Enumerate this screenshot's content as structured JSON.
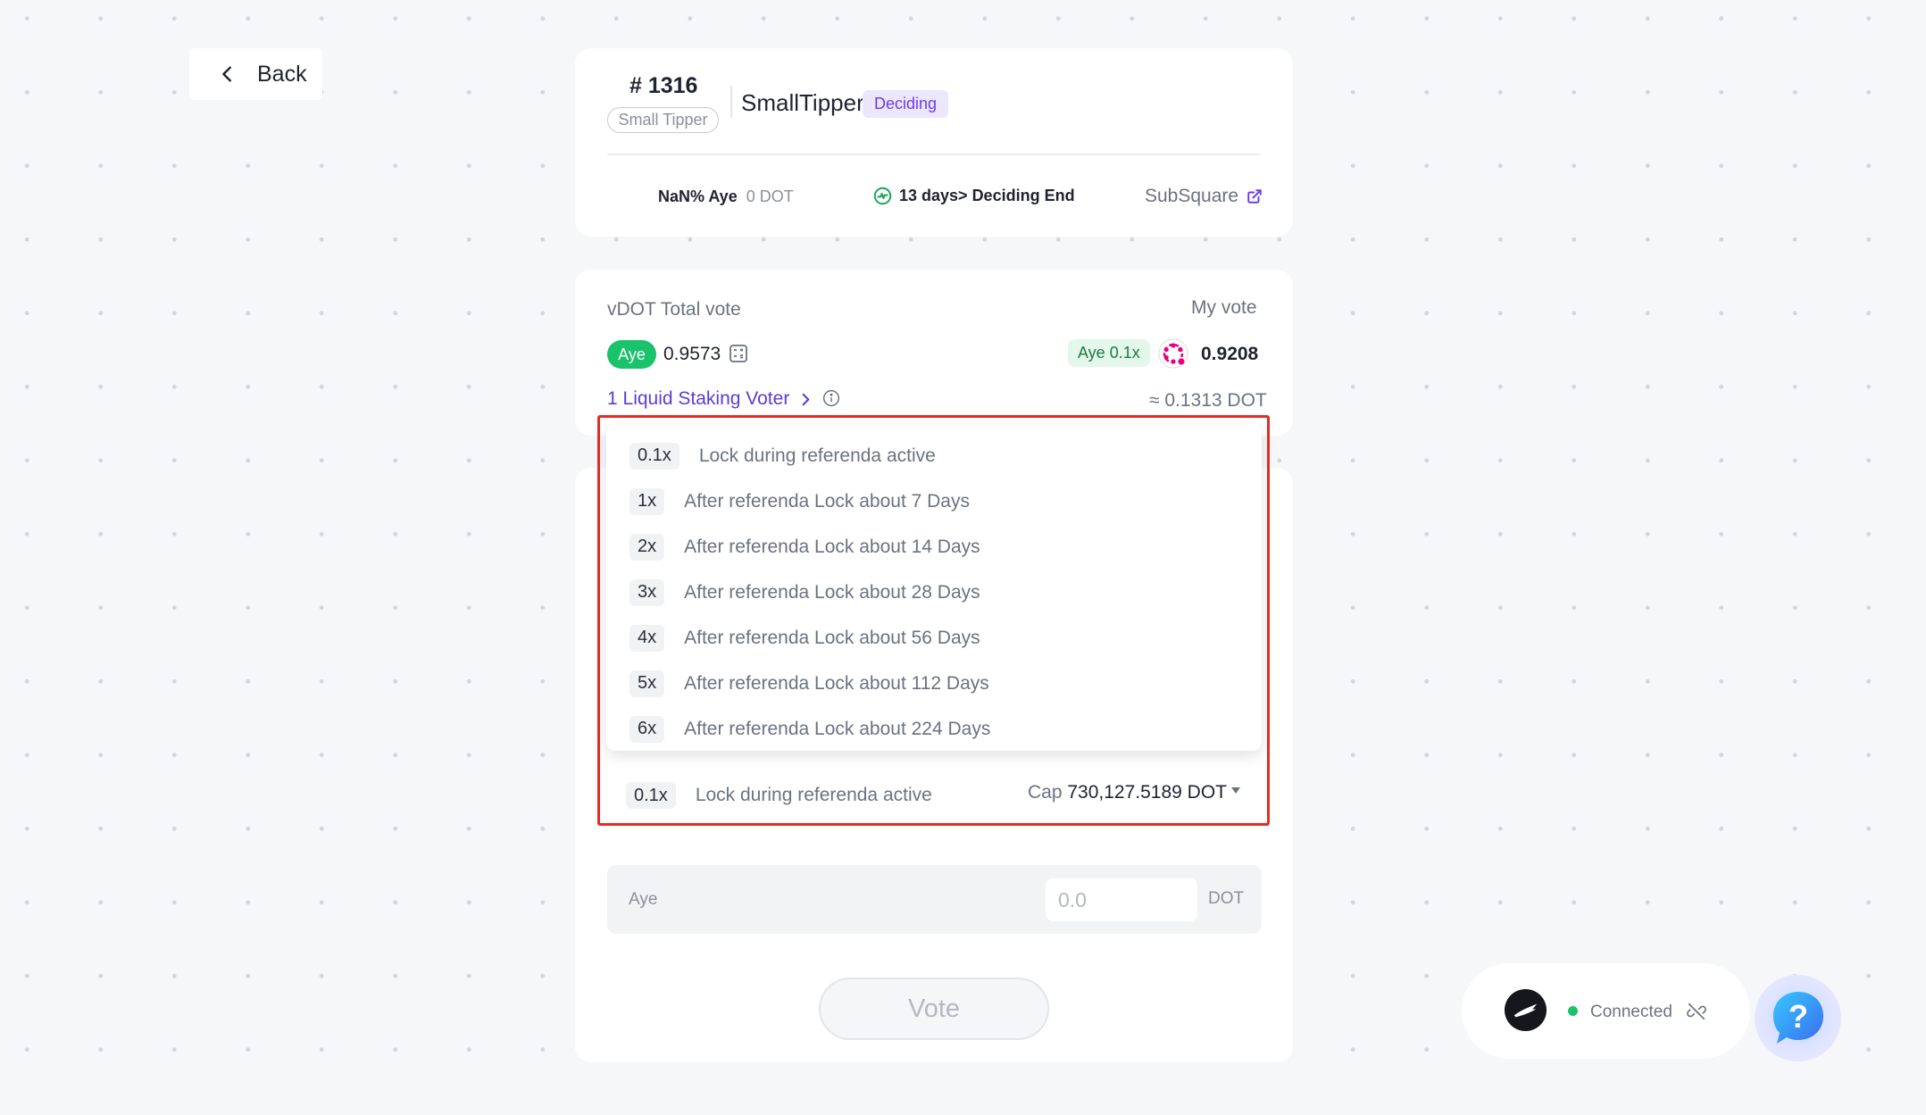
{
  "nav": {
    "back_label": "Back",
    "back_icon": "chevron-left-icon"
  },
  "referendum": {
    "number": "# 1316",
    "track": "Small Tipper",
    "title": "SmallTipper",
    "status": "Deciding",
    "aye_percent": "NaN% Aye",
    "aye_amount": "0 DOT",
    "deciding_text": "13 days> Deciding End",
    "link_label": "SubSquare"
  },
  "votes": {
    "total_label": "vDOT Total vote",
    "my_vote_label": "My vote",
    "aye_label": "Aye",
    "total_value": "0.9573",
    "my_vote_badge": "Aye 0.1x",
    "my_vote_value": "0.9208",
    "voters_link": "1 Liquid Staking Voter",
    "approx_dot": "≈ 0.1313 DOT"
  },
  "conviction_options": [
    {
      "multiplier": "0.1x",
      "label": "Lock during referenda active"
    },
    {
      "multiplier": "1x",
      "label": "After referenda Lock about 7 Days"
    },
    {
      "multiplier": "2x",
      "label": "After referenda Lock about 14 Days"
    },
    {
      "multiplier": "3x",
      "label": "After referenda Lock about 28 Days"
    },
    {
      "multiplier": "4x",
      "label": "After referenda Lock about 56 Days"
    },
    {
      "multiplier": "5x",
      "label": "After referenda Lock about 112 Days"
    },
    {
      "multiplier": "6x",
      "label": "After referenda Lock about 224 Days"
    }
  ],
  "selected_conviction": {
    "multiplier": "0.1x",
    "label": "Lock during referenda active",
    "cap_label": "Cap",
    "cap_value": "730,127.5189 DOT"
  },
  "vote_form": {
    "direction_label": "Aye",
    "amount_placeholder": "0.0",
    "unit": "DOT",
    "submit_label": "Vote"
  },
  "wallet": {
    "status": "Connected"
  },
  "colors": {
    "aye_green": "#19c26b",
    "accent_purple": "#6c3bef",
    "highlight_red": "#e62b25"
  }
}
